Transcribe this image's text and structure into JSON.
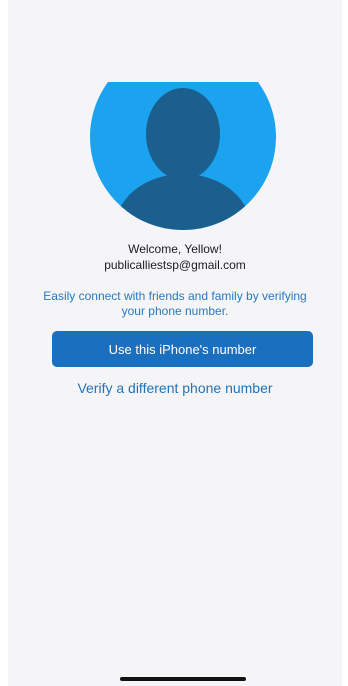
{
  "profile": {
    "welcome": "Welcome, Yellow!",
    "email": "publicalliestsp@gmail.com"
  },
  "info": {
    "text": "Easily connect with friends and family by verifying your phone number."
  },
  "actions": {
    "primary_label": "Use this iPhone's number",
    "secondary_label": "Verify a different phone number"
  },
  "colors": {
    "accent": "#1a6fbf",
    "avatar_bg": "#1ba3ef",
    "link": "#2274b8"
  },
  "icons": {
    "avatar": "person-silhouette-icon"
  }
}
